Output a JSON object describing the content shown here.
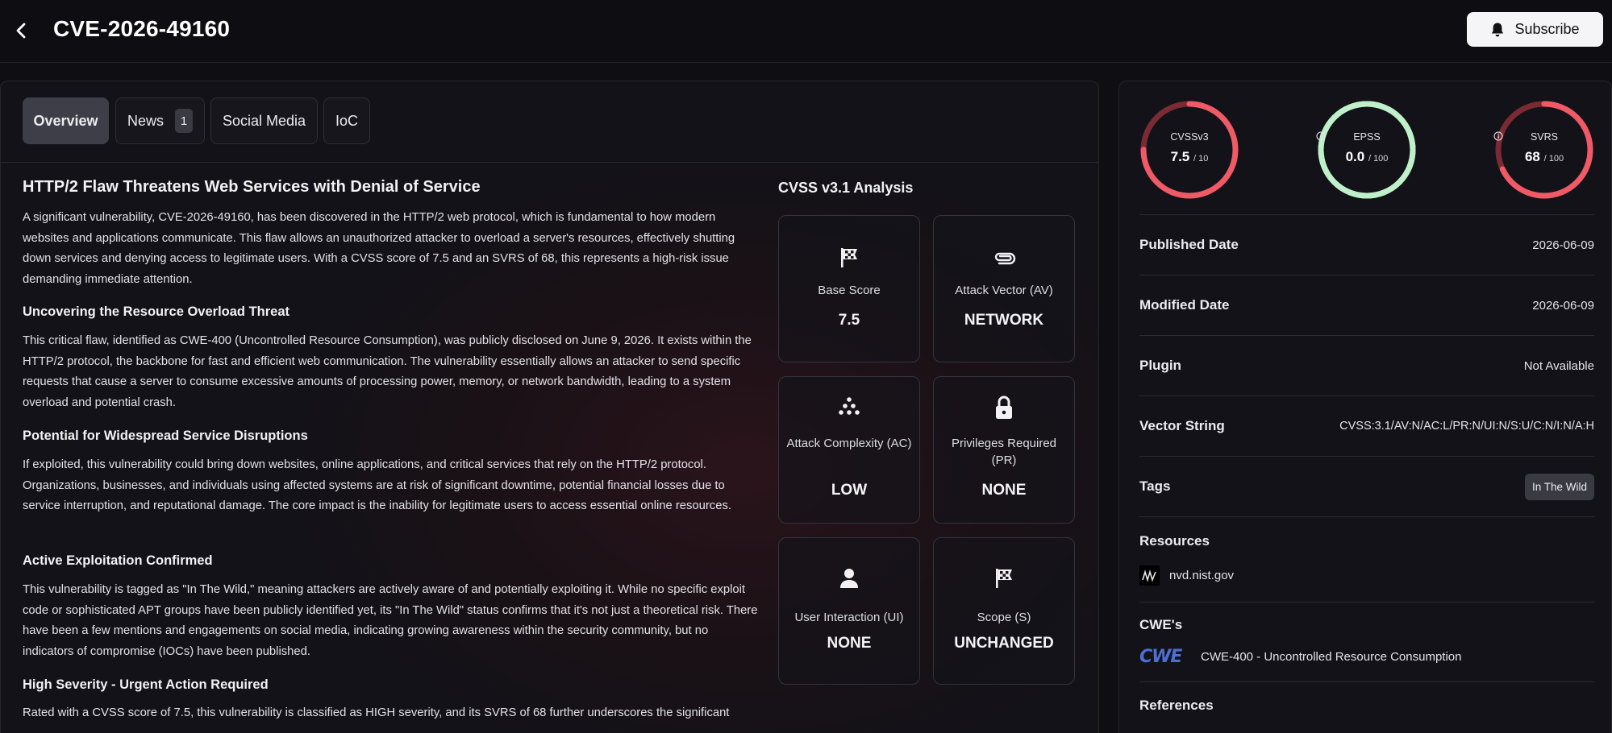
{
  "header": {
    "title": "CVE-2026-49160",
    "subscribe_label": "Subscribe"
  },
  "tabs": [
    {
      "label": "Overview",
      "active": true
    },
    {
      "label": "News",
      "badge": "1"
    },
    {
      "label": "Social Media"
    },
    {
      "label": "IoC"
    }
  ],
  "article": {
    "title": "HTTP/2 Flaw Threatens Web Services with Denial of Service",
    "intro": "A significant vulnerability, CVE-2026-49160, has been discovered in the HTTP/2 web protocol, which is fundamental to how modern websites and applications communicate. This flaw allows an unauthorized attacker to overload a server's resources, effectively shutting down services and denying access to legitimate users. With a CVSS score of 7.5 and an SVRS of 68, this represents a high-risk issue demanding immediate attention.",
    "sections": [
      {
        "heading": "Uncovering the Resource Overload Threat",
        "body": "This critical flaw, identified as CWE-400 (Uncontrolled Resource Consumption), was publicly disclosed on June 9, 2026. It exists within the HTTP/2 protocol, the backbone for fast and efficient web communication. The vulnerability essentially allows an attacker to send specific requests that cause a server to consume excessive amounts of processing power, memory, or network bandwidth, leading to a system overload and potential crash."
      },
      {
        "heading": "Potential for Widespread Service Disruptions",
        "body": "If exploited, this vulnerability could bring down websites, online applications, and critical services that rely on the HTTP/2 protocol. Organizations, businesses, and individuals using affected systems are at risk of significant downtime, potential financial losses due to service interruption, and reputational damage. The core impact is the inability for legitimate users to access essential online resources."
      },
      {
        "heading": "Active Exploitation Confirmed",
        "body": "This vulnerability is tagged as \"In The Wild,\" meaning attackers are actively aware of and potentially exploiting it. While no specific exploit code or sophisticated APT groups have been publicly identified yet, its \"In The Wild\" status confirms that it's not just a theoretical risk. There have been a few mentions and engagements on social media, indicating growing awareness within the security community, but no indicators of compromise (IOCs) have been published."
      },
      {
        "heading": "High Severity - Urgent Action Required",
        "body": "Rated with a CVSS score of 7.5, this vulnerability is classified as HIGH severity, and its SVRS of 68 further underscores the significant"
      }
    ]
  },
  "cvss_analysis": {
    "title": "CVSS v3.1 Analysis",
    "metrics": [
      {
        "icon": "checkered-flag-icon",
        "label": "Base Score",
        "value": "7.5"
      },
      {
        "icon": "paperclip-icon",
        "label": "Attack Vector (AV)",
        "value": "NETWORK"
      },
      {
        "icon": "dots-triangle-icon",
        "label": "Attack Complexity (AC)",
        "value": "LOW"
      },
      {
        "icon": "lock-icon",
        "label": "Privileges Required (PR)",
        "value": "NONE"
      },
      {
        "icon": "user-icon",
        "label": "User Interaction (UI)",
        "value": "NONE"
      },
      {
        "icon": "checkered-flag-icon",
        "label": "Scope (S)",
        "value": "UNCHANGED"
      }
    ]
  },
  "scores": [
    {
      "name": "CVSSv3",
      "value": "7.5",
      "max": "/ 10",
      "fraction": 0.75,
      "color": "#ef5a66",
      "track": "#7a2a33",
      "info": false
    },
    {
      "name": "EPSS",
      "value": "0.0",
      "max": "/ 100",
      "fraction": 1.0,
      "color": "#bff0c9",
      "track": "#bff0c9",
      "info": true
    },
    {
      "name": "SVRS",
      "value": "68",
      "max": "/ 100",
      "fraction": 0.68,
      "color": "#ef5a66",
      "track": "#7a2a33",
      "info": true
    }
  ],
  "details": {
    "published_label": "Published Date",
    "published_value": "2026-06-09",
    "modified_label": "Modified Date",
    "modified_value": "2026-06-09",
    "plugin_label": "Plugin",
    "plugin_value": "Not Available",
    "vector_label": "Vector String",
    "vector_value": "CVSS:3.1/AV:N/AC:L/PR:N/UI:N/S:U/C:N/I:N/A:H",
    "tags_label": "Tags",
    "tags": [
      "In The Wild"
    ]
  },
  "resources": {
    "label": "Resources",
    "items": [
      {
        "icon": "nvd-logo-icon",
        "text": "nvd.nist.gov"
      }
    ]
  },
  "cwes": {
    "label": "CWE's",
    "items": [
      {
        "logo": "CWE",
        "text": "CWE-400 - Uncontrolled Resource Consumption"
      }
    ]
  },
  "references": {
    "label": "References"
  },
  "colors": {
    "background": "#0e0e13",
    "danger": "#ef5a66",
    "safe": "#bff0c9"
  }
}
